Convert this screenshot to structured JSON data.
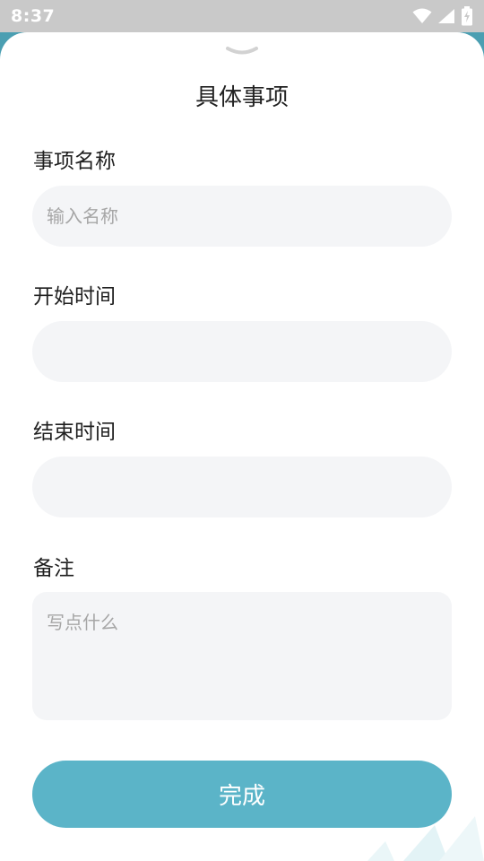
{
  "status_bar": {
    "time": "8:37",
    "icons": [
      "wifi-icon",
      "cellular-signal-icon",
      "battery-charging-icon"
    ]
  },
  "sheet": {
    "title": "具体事项",
    "handle_icon": "chevron-down-icon"
  },
  "form": {
    "name": {
      "label": "事项名称",
      "placeholder": "输入名称",
      "value": ""
    },
    "start_time": {
      "label": "开始时间",
      "value": ""
    },
    "end_time": {
      "label": "结束时间",
      "value": ""
    },
    "notes": {
      "label": "备注",
      "placeholder": "写点什么",
      "value": ""
    }
  },
  "submit": {
    "label": "完成"
  },
  "colors": {
    "accent": "#5bb4c8",
    "backdrop": "#4b9fb2",
    "input_bg": "#f4f5f7",
    "status_bar": "#c9c9c9"
  }
}
